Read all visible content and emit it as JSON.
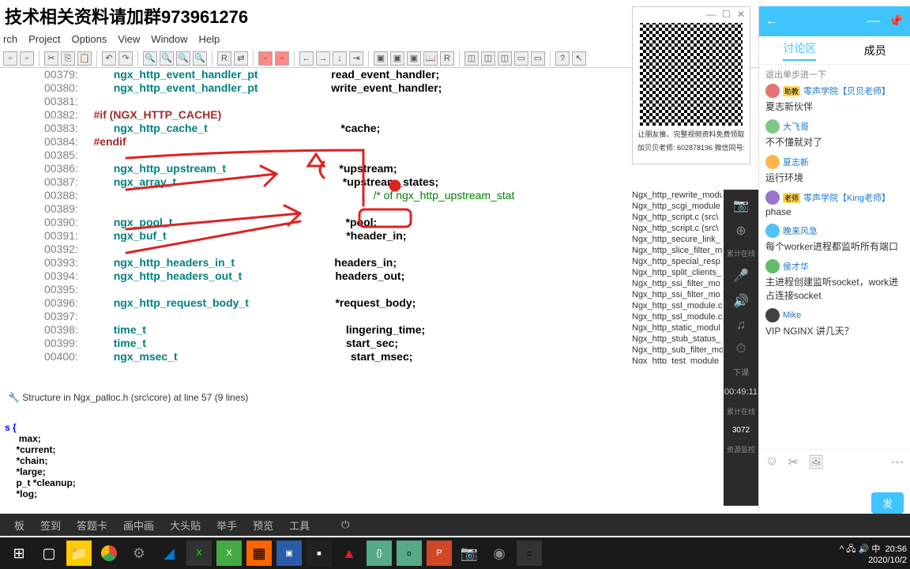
{
  "banner": "技术相关资料请加群973961276",
  "menu": [
    "rch",
    "Project",
    "Options",
    "View",
    "Window",
    "Help"
  ],
  "code": [
    {
      "n": "00379:",
      "t": "ngx_http_event_handler_pt",
      "v": "read_event_handler;"
    },
    {
      "n": "00380:",
      "t": "ngx_http_event_handler_pt",
      "v": "write_event_handler;"
    },
    {
      "n": "00381:",
      "t": "",
      "v": ""
    },
    {
      "n": "00382:",
      "pp": "#if (NGX_HTTP_CACHE)"
    },
    {
      "n": "00383:",
      "t": "ngx_http_cache_t",
      "v": "*cache;"
    },
    {
      "n": "00384:",
      "pp": "#endif"
    },
    {
      "n": "00385:",
      "t": "",
      "v": ""
    },
    {
      "n": "00386:",
      "t": "ngx_http_upstream_t",
      "v": "*upstream;"
    },
    {
      "n": "00387:",
      "t": "ngx_array_t",
      "v": "*upstream_states;"
    },
    {
      "n": "00388:",
      "cm": "/* of ngx_http_upstream_stat"
    },
    {
      "n": "00389:",
      "t": "",
      "v": ""
    },
    {
      "n": "00390:",
      "t": "ngx_pool_t",
      "v": "*pool;"
    },
    {
      "n": "00391:",
      "t": "ngx_buf_t",
      "v": "*header_in;"
    },
    {
      "n": "00392:",
      "t": "",
      "v": ""
    },
    {
      "n": "00393:",
      "t": "ngx_http_headers_in_t",
      "v": "headers_in;"
    },
    {
      "n": "00394:",
      "t": "ngx_http_headers_out_t",
      "v": "headers_out;"
    },
    {
      "n": "00395:",
      "t": "",
      "v": ""
    },
    {
      "n": "00396:",
      "t": "ngx_http_request_body_t",
      "v": "*request_body;"
    },
    {
      "n": "00397:",
      "t": "",
      "v": ""
    },
    {
      "n": "00398:",
      "t": "time_t",
      "v": "lingering_time;"
    },
    {
      "n": "00399:",
      "t": "time_t",
      "v": "start_sec;"
    },
    {
      "n": "00400:",
      "t": "ngx_msec_t",
      "v": "start_msec;"
    }
  ],
  "tree": [
    "Ngx_http_rewrite_modu",
    "Ngx_http_scgi_module",
    "Ngx_http_script.c (src\\",
    "Ngx_http_script.c (src\\",
    "Ngx_http_secure_link_",
    "Ngx_http_slice_filter_m",
    "Ngx_http_special_resp",
    "Ngx_http_split_clients_",
    "Ngx_http_ssi_filter_mo",
    "Ngx_http_ssi_filter_mo",
    "Ngx_http_ssl_module.c",
    "Ngx_http_ssl_module.c",
    "Ngx_http_static_modul",
    "Ngx_http_stub_status_",
    "Ngx_http_sub_filter_mo",
    "Ngx_http_test_module"
  ],
  "status": "Structure in Ngx_palloc.h (src\\core) at line 57 (9 lines)",
  "struct": {
    "head": "s {",
    "fields": [
      " max;",
      "*current;",
      "*chain;",
      "*large;",
      "p_t  *cleanup;",
      "*log;"
    ]
  },
  "bottombar": [
    "板",
    "签到",
    "答题卡",
    "画中画",
    "大头贴",
    "举手",
    "预览",
    "工具"
  ],
  "qr": {
    "line1": "让朋友推、完整视频资料免费领取",
    "line2": "加贝贝老师: 602878196 微信同号:"
  },
  "rightpanel": {
    "tabs": [
      "讨论区",
      "成员"
    ],
    "subtitle": "退出单步进一下",
    "chats": [
      {
        "color": "#e57373",
        "tag": "助教",
        "name": "零声学院【贝贝老师】",
        "msg": "夏志新伙伴"
      },
      {
        "color": "#81c784",
        "tag": "",
        "name": "大飞哥",
        "msg": "不不懂就对了"
      },
      {
        "color": "#ffb74d",
        "tag": "",
        "name": "夏志新",
        "msg": "运行环境"
      },
      {
        "color": "#9575cd",
        "tag": "老师",
        "name": "零声学院【King老师】",
        "msg": "phase"
      },
      {
        "color": "#4fc3f7",
        "tag": "",
        "name": "晚来风急",
        "msg": "每个worker进程都监听所有端口"
      },
      {
        "color": "#66bb6a",
        "tag": "",
        "name": "侯才华",
        "msg": "主进程创建监听socket，work进占连接socket"
      },
      {
        "color": "#424242",
        "tag": "",
        "name": "Mike",
        "msg": "VIP NGINX 讲几天？"
      }
    ],
    "send": "发"
  },
  "sidepanel": {
    "timer": "00:49:11",
    "count": "累计在线",
    "num": "3072",
    "res": "资源监控",
    "end": "下课"
  },
  "clock": {
    "time": "20:56",
    "date": "2020/10/2"
  },
  "ime": "中"
}
